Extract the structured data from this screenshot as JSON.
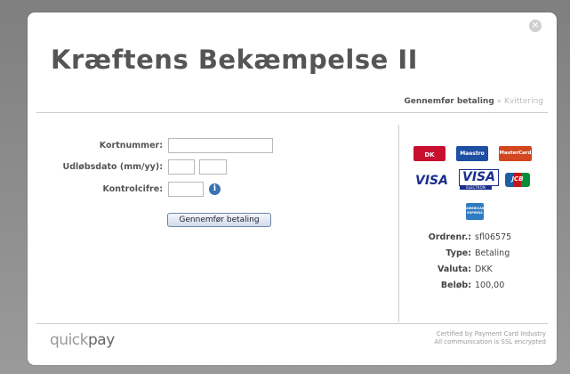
{
  "title": "Kræftens Bekæmpelse II",
  "close_symbol": "×",
  "steps": {
    "active": "Gennemfør betaling",
    "separator": "»",
    "next": "Kvittering"
  },
  "form": {
    "card_number_label": "Kortnummer:",
    "expiry_label": "Udløbsdato (mm/yy):",
    "cvc_label": "Kontrolcifre:",
    "info_symbol": "i",
    "submit_label": "Gennemfør betaling"
  },
  "cards": {
    "dk": "DK",
    "maestro": "Maestro",
    "mastercard": "MasterCard",
    "visa": "VISA",
    "visa_electron": "VISA",
    "visa_electron_sub": "ELECTRON",
    "jcb": "JCB",
    "amex": "AMERICAN EXPRESS"
  },
  "order": {
    "order_label": "Ordrenr.:",
    "order_value": "sfl06575",
    "type_label": "Type:",
    "type_value": "Betaling",
    "currency_label": "Valuta:",
    "currency_value": "DKK",
    "amount_label": "Beløb:",
    "amount_value": "100,00"
  },
  "footer": {
    "logo_quick": "quick",
    "logo_pay": "pay",
    "cert_line1": "Certified by Payment Card Industry",
    "cert_line2": "All communication is SSL encrypted"
  }
}
